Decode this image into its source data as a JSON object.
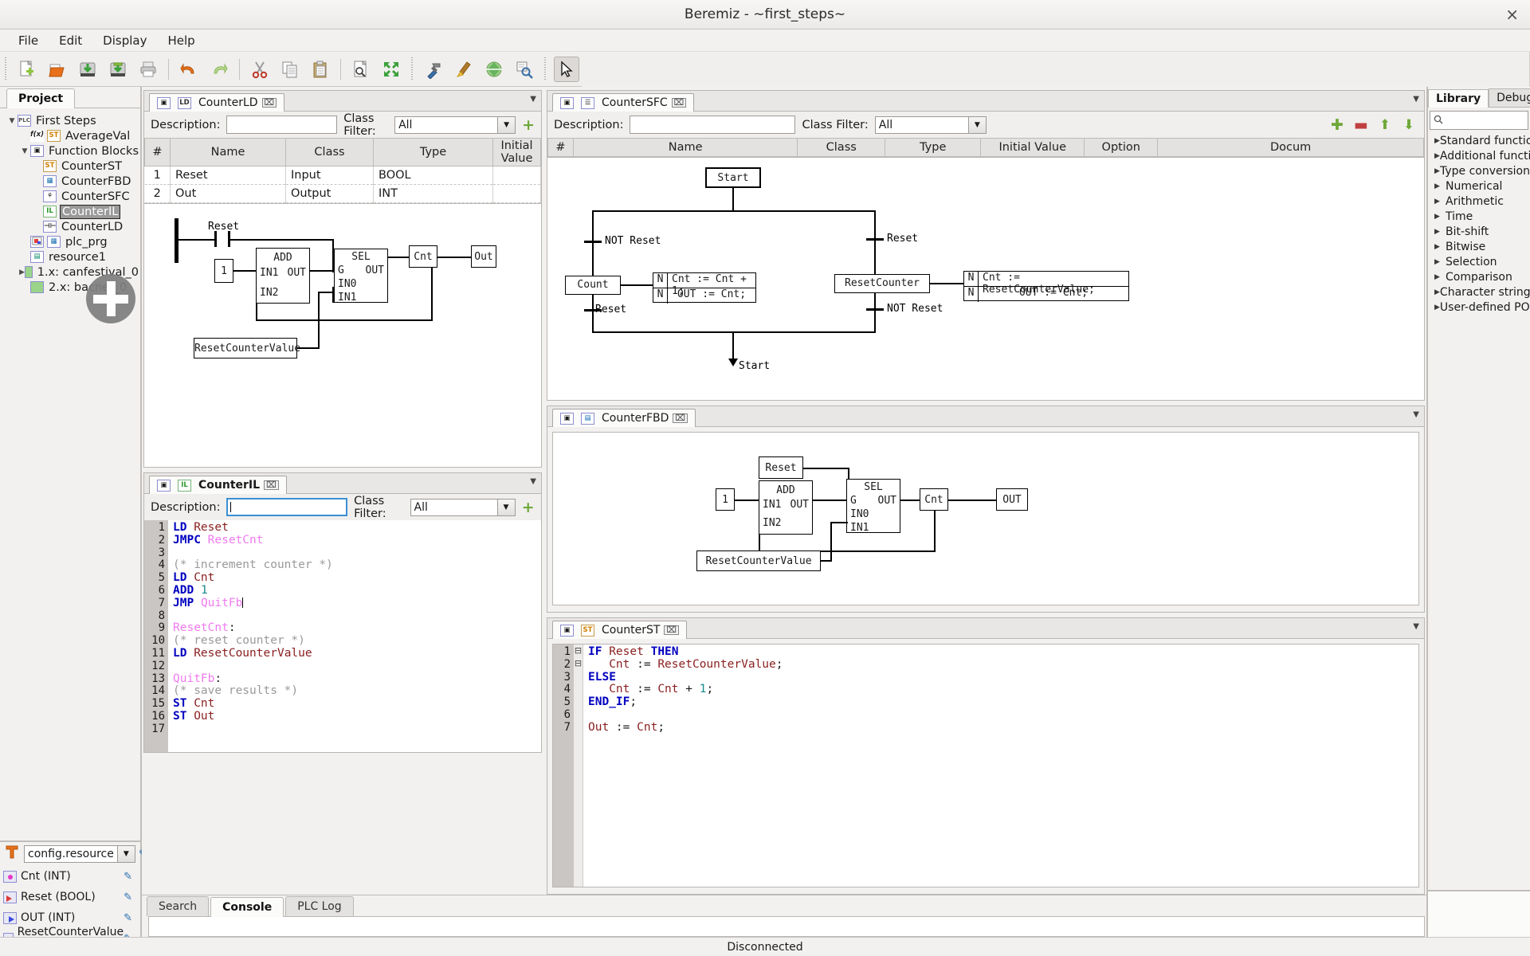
{
  "window": {
    "title": "Beremiz - ~first_steps~",
    "close_label": "×"
  },
  "menubar": {
    "items": [
      "File",
      "Edit",
      "Display",
      "Help"
    ]
  },
  "toolbar": {
    "group1": [
      "new-icon",
      "open-icon",
      "save-icon",
      "saveas-icon",
      "print-icon"
    ],
    "group2": [
      "undo-icon",
      "redo-icon"
    ],
    "group3": [
      "cut-icon",
      "copy-icon",
      "paste-icon"
    ],
    "group4": [
      "find-icon",
      "fullscreen-icon"
    ],
    "group5": [
      "build-icon",
      "clean-icon",
      "transfer-icon",
      "inspect-icon"
    ],
    "group6": [
      "pointer-icon"
    ]
  },
  "project_panel": {
    "tab_label": "Project",
    "tree": [
      {
        "label": "First Steps",
        "indent": 0,
        "arrow": "down",
        "icon": "plc-project-icon",
        "icon_text": "PLC",
        "selected": false
      },
      {
        "label": "AverageVal",
        "indent": 1,
        "arrow": "none",
        "icon": "function-st-icon",
        "icon_text": "f(x)",
        "badge": "ST",
        "selected": false
      },
      {
        "label": "Function Blocks",
        "indent": 1,
        "arrow": "down",
        "icon": "folder-fb-icon",
        "icon_text": "▣",
        "selected": false
      },
      {
        "label": "CounterST",
        "indent": 2,
        "arrow": "none",
        "icon": "pou-st-icon",
        "icon_text": "ST",
        "selected": false
      },
      {
        "label": "CounterFBD",
        "indent": 2,
        "arrow": "none",
        "icon": "pou-fbd-icon",
        "icon_text": "FBD",
        "selected": false
      },
      {
        "label": "CounterSFC",
        "indent": 2,
        "arrow": "none",
        "icon": "pou-sfc-icon",
        "icon_text": "SFC",
        "selected": false
      },
      {
        "label": "CounterIL",
        "indent": 2,
        "arrow": "none",
        "icon": "pou-il-icon",
        "icon_text": "IL",
        "selected": true
      },
      {
        "label": "CounterLD",
        "indent": 2,
        "arrow": "none",
        "icon": "pou-ld-icon",
        "icon_text": "LD",
        "selected": false
      },
      {
        "label": "plc_prg",
        "indent": 1,
        "arrow": "none",
        "icon": "program-fbd-icon",
        "icon_text": "FBD",
        "selected": false
      },
      {
        "label": "resource1",
        "indent": 1,
        "arrow": "none",
        "icon": "resource-icon",
        "icon_text": "▤",
        "selected": false
      },
      {
        "label": "1.x: canfestival_0",
        "indent": 1,
        "arrow": "right",
        "icon": "extension-icon",
        "icon_text": "",
        "selected": false
      },
      {
        "label": "2.x: bacnet_0",
        "indent": 1,
        "arrow": "none",
        "icon": "extension-icon",
        "icon_text": "",
        "selected": false
      }
    ],
    "drag_cursor": "drag-add-cursor"
  },
  "instances_panel": {
    "selector_value": "config.resource",
    "variables": [
      {
        "name": "Cnt (INT)",
        "kind": "local"
      },
      {
        "name": "Reset (BOOL)",
        "kind": "input"
      },
      {
        "name": "OUT (INT)",
        "kind": "output"
      },
      {
        "name": "ResetCounterValue (INT)",
        "kind": "local"
      }
    ],
    "edit_icon": "pencil-icon"
  },
  "editors": {
    "counter_ld": {
      "tab_label": "CounterLD",
      "tab_icons": [
        "pou-icon",
        "ld-icon"
      ],
      "close_label": "⌧",
      "description_label": "Description:",
      "description_value": "",
      "class_filter_label": "Class Filter:",
      "class_filter_value": "All",
      "add_label": "+",
      "columns": [
        "#",
        "Name",
        "Class",
        "Type",
        "Initial Value"
      ],
      "rows": [
        {
          "num": "1",
          "name": "Reset",
          "class": "Input",
          "type": "BOOL",
          "initial": ""
        },
        {
          "num": "2",
          "name": "Out",
          "class": "Output",
          "type": "INT",
          "initial": ""
        }
      ],
      "diagram": {
        "contact_label": "Reset",
        "constant": "1",
        "add_block": {
          "name": "ADD",
          "in1": "IN1",
          "out": "OUT",
          "in2": "IN2"
        },
        "sel_block": {
          "name": "SEL",
          "g": "G",
          "out": "OUT",
          "in0": "IN0",
          "in1": "IN1"
        },
        "cnt_var": "Cnt",
        "out_var": "Out",
        "reset_value_var": "ResetCounterValue"
      }
    },
    "counter_il": {
      "tab_label": "CounterIL",
      "tab_icons": [
        "pou-icon",
        "il-icon"
      ],
      "close_label": "⌧",
      "description_label": "Description:",
      "description_value": "",
      "class_filter_label": "Class Filter:",
      "class_filter_value": "All",
      "add_label": "+",
      "code_lines": [
        {
          "n": 1,
          "tokens": [
            [
              "kw",
              "LD"
            ],
            [
              "plain",
              " "
            ],
            [
              "var",
              "Reset"
            ]
          ]
        },
        {
          "n": 2,
          "tokens": [
            [
              "kw",
              "JMPC"
            ],
            [
              "plain",
              " "
            ],
            [
              "lbl",
              "ResetCnt"
            ]
          ]
        },
        {
          "n": 3,
          "tokens": []
        },
        {
          "n": 4,
          "tokens": [
            [
              "cmt",
              "(* increment counter *)"
            ]
          ]
        },
        {
          "n": 5,
          "tokens": [
            [
              "kw",
              "LD"
            ],
            [
              "plain",
              " "
            ],
            [
              "var",
              "Cnt"
            ]
          ]
        },
        {
          "n": 6,
          "tokens": [
            [
              "kw",
              "ADD"
            ],
            [
              "plain",
              " "
            ],
            [
              "num",
              "1"
            ]
          ]
        },
        {
          "n": 7,
          "tokens": [
            [
              "kw",
              "JMP"
            ],
            [
              "plain",
              " "
            ],
            [
              "lbl",
              "QuitFb"
            ],
            [
              "caret",
              ""
            ]
          ]
        },
        {
          "n": 8,
          "tokens": []
        },
        {
          "n": 9,
          "tokens": [
            [
              "lbl",
              "ResetCnt"
            ],
            [
              "plain",
              ":"
            ]
          ]
        },
        {
          "n": 10,
          "tokens": [
            [
              "cmt",
              "(* reset counter *)"
            ]
          ]
        },
        {
          "n": 11,
          "tokens": [
            [
              "kw",
              "LD"
            ],
            [
              "plain",
              " "
            ],
            [
              "var",
              "ResetCounterValue"
            ]
          ]
        },
        {
          "n": 12,
          "tokens": []
        },
        {
          "n": 13,
          "tokens": [
            [
              "lbl",
              "QuitFb"
            ],
            [
              "plain",
              ":"
            ]
          ]
        },
        {
          "n": 14,
          "tokens": [
            [
              "cmt",
              "(* save results *)"
            ]
          ]
        },
        {
          "n": 15,
          "tokens": [
            [
              "kw",
              "ST"
            ],
            [
              "plain",
              " "
            ],
            [
              "var",
              "Cnt"
            ]
          ]
        },
        {
          "n": 16,
          "tokens": [
            [
              "kw",
              "ST"
            ],
            [
              "plain",
              " "
            ],
            [
              "var",
              "Out"
            ]
          ]
        },
        {
          "n": 17,
          "tokens": []
        }
      ]
    },
    "counter_sfc": {
      "tab_label": "CounterSFC",
      "tab_icons": [
        "pou-icon",
        "sfc-icon"
      ],
      "close_label": "⌧",
      "description_label": "Description:",
      "description_value": "",
      "class_filter_label": "Class Filter:",
      "class_filter_value": "All",
      "columns": [
        "#",
        "Name",
        "Class",
        "Type",
        "Initial Value",
        "Option",
        "Docum"
      ],
      "buttons": [
        "add-variable-button",
        "remove-variable-button",
        "move-up-button",
        "move-down-button"
      ],
      "diagram": {
        "start_step": "Start",
        "transition_left": "NOT Reset",
        "transition_right": "Reset",
        "step_left": "Count",
        "step_right": "ResetCounter",
        "action_left_1": "Cnt := Cnt + 1;",
        "action_left_2": "OUT := Cnt;",
        "action_right_1": "Cnt := ResetCounterValue;",
        "action_right_2": "OUT := Cnt;",
        "qualifier": "N",
        "transition_left_2": "Reset",
        "transition_right_2": "NOT Reset",
        "jump_target": "Start"
      }
    },
    "counter_fbd": {
      "tab_label": "CounterFBD",
      "tab_icons": [
        "pou-icon",
        "fbd-icon"
      ],
      "close_label": "⌧",
      "diagram": {
        "reset_var": "Reset",
        "constant": "1",
        "add_block": {
          "name": "ADD",
          "in1": "IN1",
          "out": "OUT",
          "in2": "IN2"
        },
        "sel_block": {
          "name": "SEL",
          "g": "G",
          "out": "OUT",
          "in0": "IN0",
          "in1": "IN1"
        },
        "cnt_var": "Cnt",
        "out_var": "OUT",
        "reset_value_var": "ResetCounterValue"
      }
    },
    "counter_st": {
      "tab_label": "CounterST",
      "tab_icons": [
        "pou-icon",
        "st-icon"
      ],
      "close_label": "⌧",
      "code_lines": [
        {
          "n": 1,
          "fold": true,
          "tokens": [
            [
              "kw",
              "IF"
            ],
            [
              "plain",
              " "
            ],
            [
              "var",
              "Reset"
            ],
            [
              "plain",
              " "
            ],
            [
              "kw",
              "THEN"
            ]
          ]
        },
        {
          "n": 2,
          "fold": false,
          "tokens": [
            [
              "plain",
              "   "
            ],
            [
              "var",
              "Cnt"
            ],
            [
              "plain",
              " := "
            ],
            [
              "var",
              "ResetCounterValue"
            ],
            [
              "plain",
              ";"
            ]
          ]
        },
        {
          "n": 3,
          "fold": true,
          "tokens": [
            [
              "kw",
              "ELSE"
            ]
          ]
        },
        {
          "n": 4,
          "fold": false,
          "tokens": [
            [
              "plain",
              "   "
            ],
            [
              "var",
              "Cnt"
            ],
            [
              "plain",
              " := "
            ],
            [
              "var",
              "Cnt"
            ],
            [
              "plain",
              " + "
            ],
            [
              "num",
              "1"
            ],
            [
              "plain",
              ";"
            ]
          ]
        },
        {
          "n": 5,
          "fold": false,
          "tokens": [
            [
              "kw",
              "END_IF"
            ],
            [
              "plain",
              ";"
            ]
          ]
        },
        {
          "n": 6,
          "fold": false,
          "tokens": []
        },
        {
          "n": 7,
          "fold": false,
          "tokens": [
            [
              "var",
              "Out"
            ],
            [
              "plain",
              " := "
            ],
            [
              "var",
              "Cnt"
            ],
            [
              "plain",
              ";"
            ]
          ]
        }
      ]
    }
  },
  "library_panel": {
    "tabs": [
      {
        "label": "Library",
        "selected": true
      },
      {
        "label": "Debugger",
        "selected": false
      }
    ],
    "search_placeholder": "",
    "search_value": "",
    "categories": [
      "Standard function",
      "Additional function",
      "Type conversion",
      "Numerical",
      "Arithmetic",
      "Time",
      "Bit-shift",
      "Bitwise",
      "Selection",
      "Comparison",
      "Character string",
      "User-defined POU"
    ]
  },
  "bottom_panel": {
    "tabs": [
      {
        "label": "Search",
        "selected": false
      },
      {
        "label": "Console",
        "selected": true
      },
      {
        "label": "PLC Log",
        "selected": false
      }
    ]
  },
  "statusbar": {
    "text": "Disconnected"
  }
}
